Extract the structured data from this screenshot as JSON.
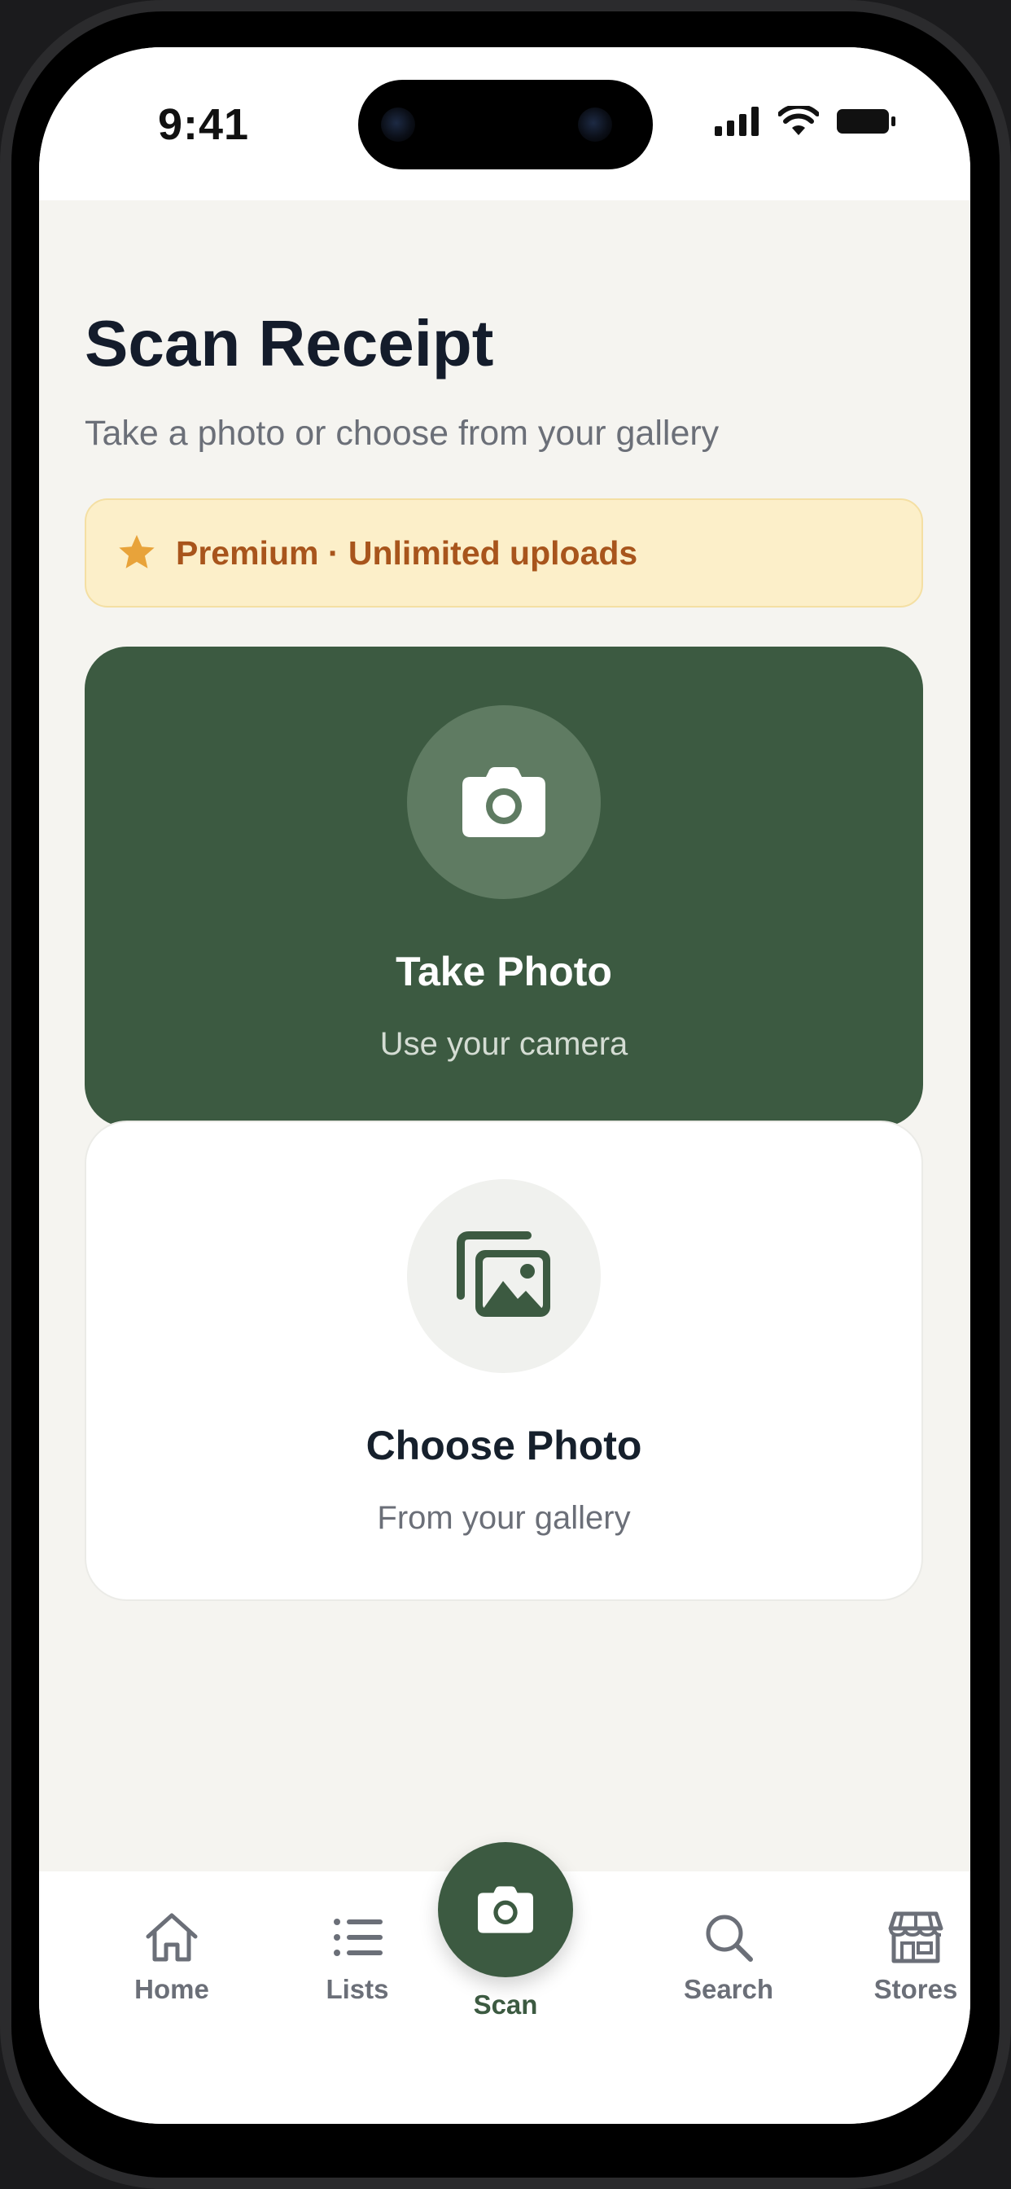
{
  "status_bar": {
    "time": "9:41"
  },
  "header": {
    "title": "Scan Receipt",
    "subtitle": "Take a photo or choose from your gallery"
  },
  "premium": {
    "icon": "star-icon",
    "label": "Premium · Unlimited uploads"
  },
  "options": {
    "take_photo": {
      "icon": "camera-icon",
      "title": "Take Photo",
      "subtitle": "Use your camera"
    },
    "choose_photo": {
      "icon": "gallery-icon",
      "title": "Choose Photo",
      "subtitle": "From your gallery"
    }
  },
  "tab_bar": {
    "items": [
      {
        "label": "Home",
        "icon": "home-icon"
      },
      {
        "label": "Lists",
        "icon": "list-icon"
      },
      {
        "label": "Scan",
        "icon": "camera-icon",
        "active": true
      },
      {
        "label": "Search",
        "icon": "search-icon"
      },
      {
        "label": "Stores",
        "icon": "store-icon"
      }
    ]
  },
  "colors": {
    "accent_green": "#3c5a41",
    "premium_bg": "#fcefc9",
    "premium_text": "#a8551c",
    "star": "#e8a33a",
    "background": "#f5f4f0"
  }
}
